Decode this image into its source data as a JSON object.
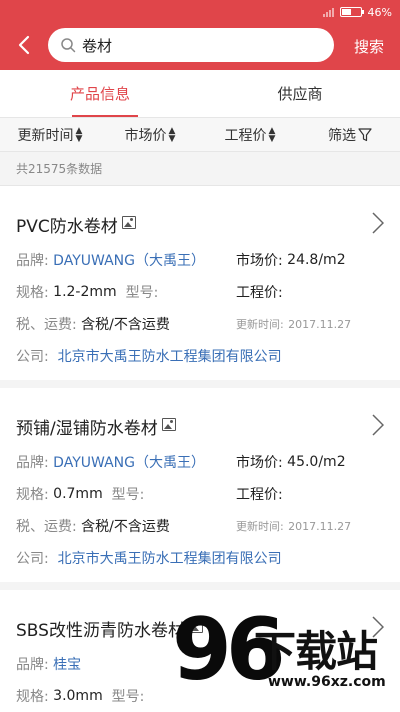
{
  "status": {
    "battery": "46%"
  },
  "header": {
    "query": "卷材",
    "search_label": "搜索"
  },
  "tabs": [
    {
      "label": "产品信息",
      "active": true
    },
    {
      "label": "供应商",
      "active": false
    }
  ],
  "sort": [
    {
      "label": "更新时间"
    },
    {
      "label": "市场价"
    },
    {
      "label": "工程价"
    },
    {
      "label": "筛选"
    }
  ],
  "count": "共21575条数据",
  "labels": {
    "brand": "品牌:",
    "spec": "规格:",
    "model": "型号:",
    "tax": "税、运费:",
    "company": "公司:",
    "market": "市场价:",
    "eng": "工程价:",
    "updated": "更新时间:"
  },
  "items": [
    {
      "title": "PVC防水卷材",
      "brand": "DAYUWANG（大禹王）",
      "market_price": "24.8/m2",
      "spec": "1.2-2mm",
      "tax": "含税/不含运费",
      "updated": "2017.11.27",
      "company": "北京市大禹王防水工程集团有限公司"
    },
    {
      "title": "预铺/湿铺防水卷材",
      "brand": "DAYUWANG（大禹王）",
      "market_price": "45.0/m2",
      "spec": "0.7mm",
      "tax": "含税/不含运费",
      "updated": "2017.11.27",
      "company": "北京市大禹王防水工程集团有限公司"
    },
    {
      "title": "SBS改性沥青防水卷材",
      "brand": "桂宝",
      "spec": "3.0mm"
    }
  ],
  "watermark": {
    "digits": "96",
    "text": "下载站",
    "url": "www.96xz.com"
  },
  "colors": {
    "accent": "#e0454a",
    "link": "#3a6fb6",
    "logo_green": "#2ea34a"
  }
}
